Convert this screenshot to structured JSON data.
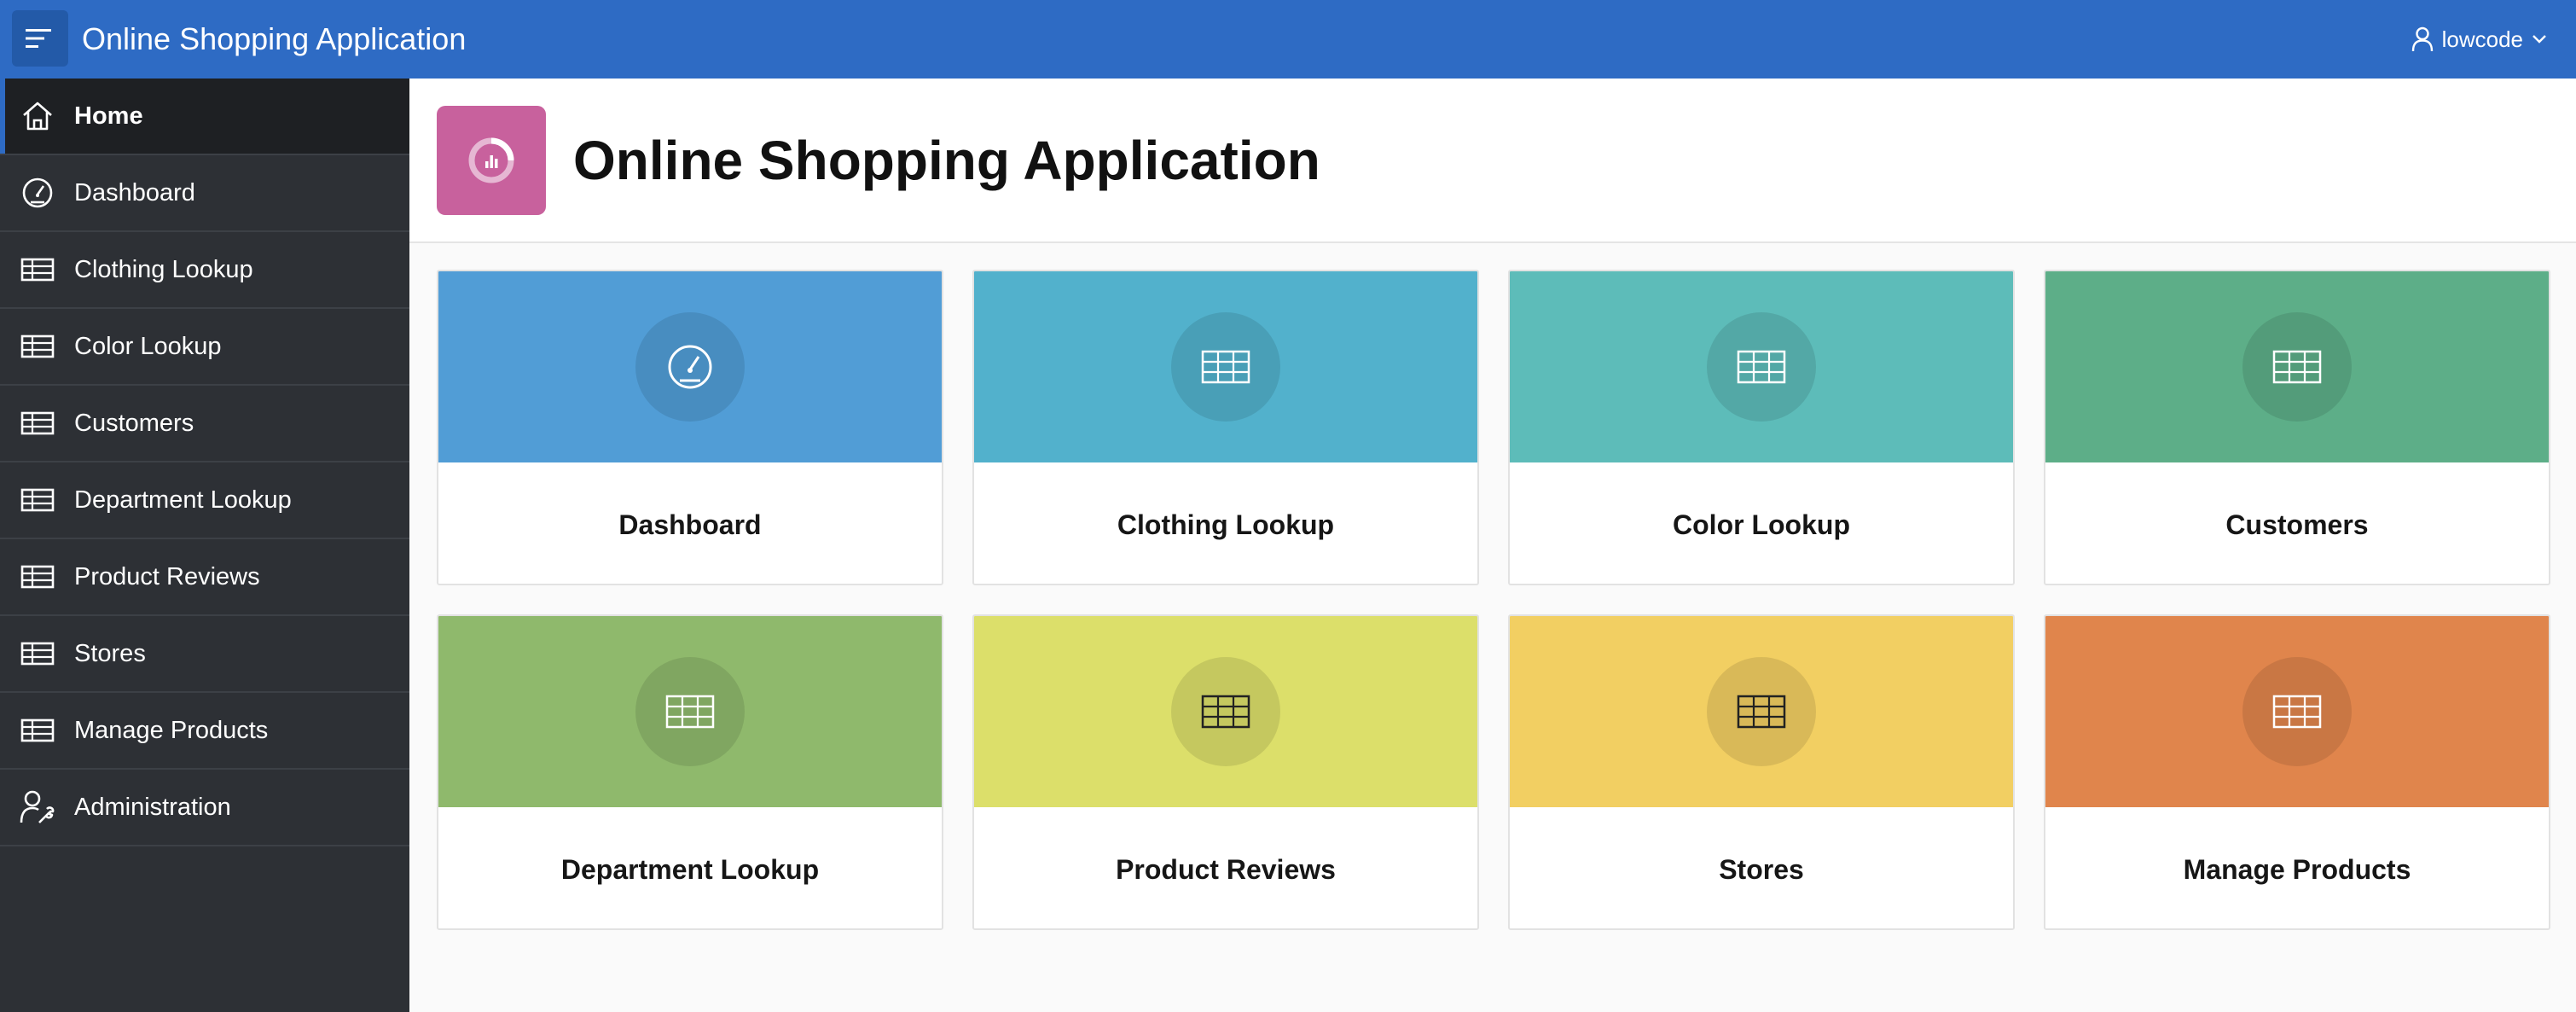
{
  "header": {
    "title": "Online Shopping Application",
    "user": "lowcode",
    "color": "#2e6bc4"
  },
  "sidebar": {
    "items": [
      {
        "label": "Home",
        "icon": "home-icon",
        "active": true
      },
      {
        "label": "Dashboard",
        "icon": "dashboard-icon"
      },
      {
        "label": "Clothing Lookup",
        "icon": "table-icon"
      },
      {
        "label": "Color Lookup",
        "icon": "table-icon"
      },
      {
        "label": "Customers",
        "icon": "table-icon"
      },
      {
        "label": "Department Lookup",
        "icon": "table-icon"
      },
      {
        "label": "Product Reviews",
        "icon": "table-icon"
      },
      {
        "label": "Stores",
        "icon": "table-icon"
      },
      {
        "label": "Manage Products",
        "icon": "table-icon"
      },
      {
        "label": "Administration",
        "icon": "user-wrench-icon"
      }
    ]
  },
  "hero": {
    "title": "Online Shopping Application",
    "icon": "app-chart-icon",
    "color": "#c8619d"
  },
  "cards": [
    {
      "label": "Dashboard",
      "icon": "dashboard-icon",
      "color": "#519dd6",
      "icon_color": "#ffffff"
    },
    {
      "label": "Clothing Lookup",
      "icon": "table-icon",
      "color": "#52b1cc",
      "icon_color": "#ffffff"
    },
    {
      "label": "Color Lookup",
      "icon": "table-icon",
      "color": "#5dbcb9",
      "icon_color": "#ffffff"
    },
    {
      "label": "Customers",
      "icon": "table-icon",
      "color": "#5dae88",
      "icon_color": "#ffffff"
    },
    {
      "label": "Department Lookup",
      "icon": "table-icon",
      "color": "#8fb96c",
      "icon_color": "#ffffff"
    },
    {
      "label": "Product Reviews",
      "icon": "table-icon",
      "color": "#dcdf6a",
      "icon_color": "#222222"
    },
    {
      "label": "Stores",
      "icon": "table-icon",
      "color": "#f2cf62",
      "icon_color": "#222222"
    },
    {
      "label": "Manage Products",
      "icon": "table-icon",
      "color": "#e0854c",
      "icon_color": "#ffffff"
    }
  ]
}
